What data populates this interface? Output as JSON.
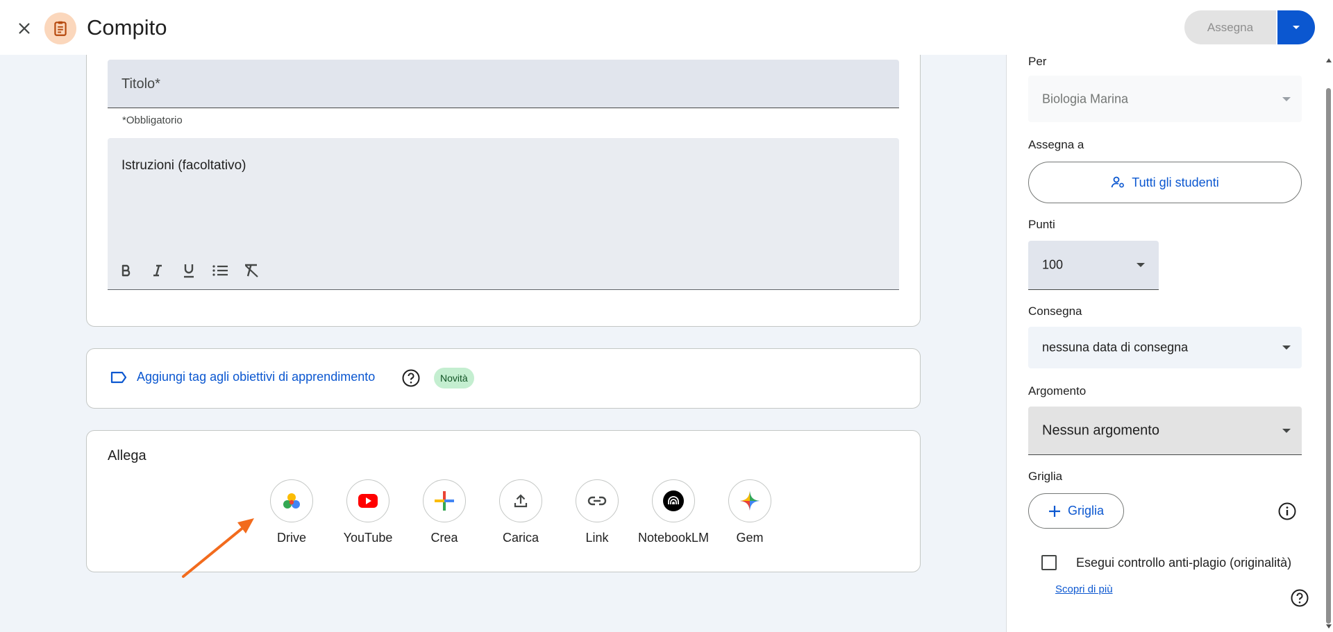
{
  "header": {
    "title": "Compito",
    "assign_label": "Assegna",
    "close_icon": "close-icon",
    "app_icon": "assignment-icon"
  },
  "form": {
    "title_placeholder": "Titolo*",
    "required_note": "*Obbligatorio",
    "instructions_placeholder": "Istruzioni (facoltativo)",
    "format_tools": [
      "bold-icon",
      "italic-icon",
      "underline-icon",
      "bulleted-list-icon",
      "clear-format-icon"
    ]
  },
  "tags": {
    "link_label": "Aggiungi tag agli obiettivi di apprendimento",
    "badge": "Novità"
  },
  "attach": {
    "title": "Allega",
    "items": [
      {
        "label": "Drive",
        "icon": "drive-icon"
      },
      {
        "label": "YouTube",
        "icon": "youtube-icon"
      },
      {
        "label": "Crea",
        "icon": "create-plus-icon"
      },
      {
        "label": "Carica",
        "icon": "upload-icon"
      },
      {
        "label": "Link",
        "icon": "link-icon"
      },
      {
        "label": "NotebookLM",
        "icon": "notebooklm-icon"
      },
      {
        "label": "Gem",
        "icon": "gem-icon"
      }
    ]
  },
  "side": {
    "for_label": "Per",
    "class_value": "Biologia Marina",
    "assign_to_label": "Assegna a",
    "students_label": "Tutti gli studenti",
    "points_label": "Punti",
    "points_value": "100",
    "due_label": "Consegna",
    "due_value": "nessuna data di consegna",
    "topic_label": "Argomento",
    "topic_value": "Nessun argomento",
    "rubric_label": "Griglia",
    "rubric_button": "Griglia",
    "plagiarism_label": "Esegui controllo anti-plagio (originalità)",
    "learn_more": "Scopri di più"
  },
  "colors": {
    "accent": "#0b57d0",
    "annotation_arrow": "#f26b1d",
    "app_icon_bg": "#fbd7bc"
  }
}
